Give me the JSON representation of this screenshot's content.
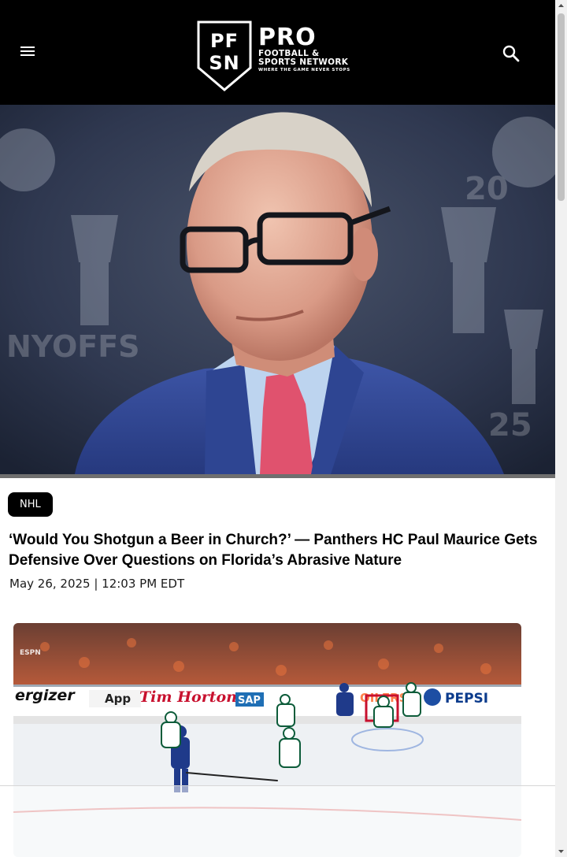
{
  "header": {
    "logo_mark": "PFSN",
    "logo_pro": "PRO",
    "logo_line1": "FOOTBALL &",
    "logo_line2": "SPORTS NETWORK",
    "logo_tagline": "WHERE THE GAME NEVER STOPS",
    "menu_icon": "hamburger-menu-icon",
    "search_icon": "search-icon"
  },
  "article": {
    "category": "NHL",
    "headline": "‘Would You Shotgun a Beer in Church?’ — Panthers HC Paul Maurice Gets Defensive Over Questions on Florida’s Abrasive Nature",
    "dateline": "May 26, 2025 | 12:03 PM EDT"
  },
  "video": {
    "boards": [
      "ergizer",
      "App",
      "Tim Hortons",
      "SAP",
      "OILERS",
      "PEPSI"
    ],
    "network_bug": "ESPN"
  },
  "colors": {
    "header_bg": "#000000",
    "pill_bg": "#000000",
    "text": "#000000",
    "tim_hortons_red": "#c8102e",
    "oilers_orange": "#ff4c00",
    "stars_green": "#006847"
  }
}
